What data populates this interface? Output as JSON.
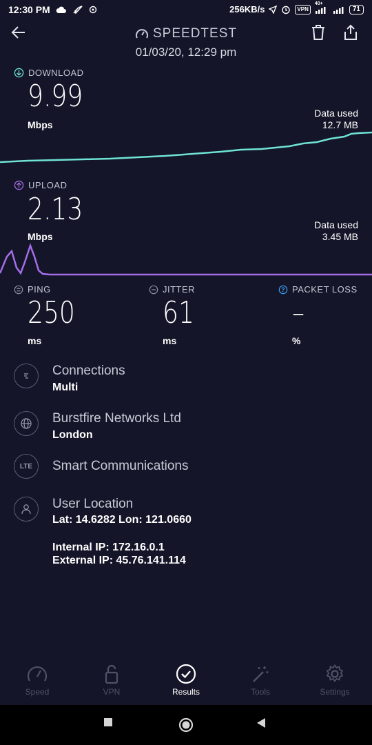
{
  "status_bar": {
    "time": "12:30 PM",
    "speed": "256KB/s",
    "vpn": "VPN",
    "network": "40+",
    "battery": "71"
  },
  "header": {
    "title": "SPEEDTEST",
    "datetime": "01/03/20, 12:29 pm"
  },
  "download": {
    "label": "DOWNLOAD",
    "value": "9.99",
    "unit": "Mbps",
    "data_used_label": "Data used",
    "data_used": "12.7 MB",
    "color": "#6fe3d6"
  },
  "upload": {
    "label": "UPLOAD",
    "value": "2.13",
    "unit": "Mbps",
    "data_used_label": "Data used",
    "data_used": "3.45 MB",
    "color": "#a56ee8"
  },
  "ping": {
    "label": "PING",
    "value": "250",
    "unit": "ms"
  },
  "jitter": {
    "label": "JITTER",
    "value": "61",
    "unit": "ms"
  },
  "packet_loss": {
    "label": "PACKET LOSS",
    "value": "–",
    "unit": "%"
  },
  "details": {
    "connections": {
      "title": "Connections",
      "value": "Multi"
    },
    "server": {
      "title": "Burstfire Networks Ltd",
      "value": "London"
    },
    "provider": {
      "title": "Smart Communications",
      "icon_text": "LTE"
    },
    "location": {
      "title": "User Location",
      "coords": "Lat: 14.6282 Lon: 121.0660",
      "internal_ip": "Internal IP: 172.16.0.1",
      "external_ip": "External IP: 45.76.141.114"
    }
  },
  "nav": {
    "speed": "Speed",
    "vpn": "VPN",
    "results": "Results",
    "tools": "Tools",
    "settings": "Settings"
  }
}
